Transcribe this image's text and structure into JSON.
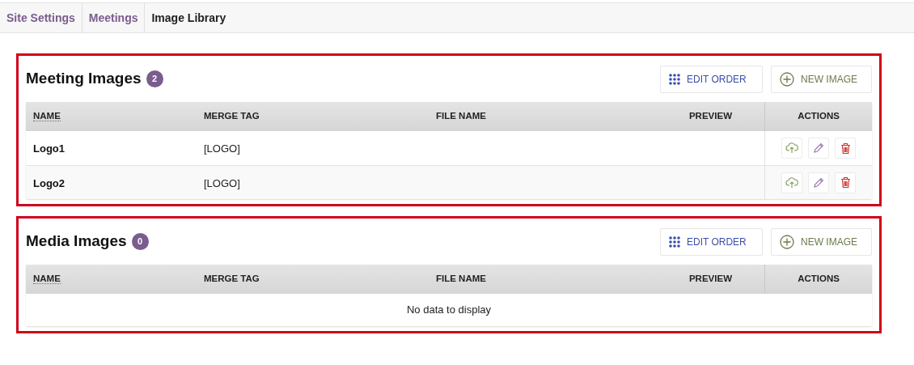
{
  "tabs": [
    {
      "label": "Site Settings",
      "selected": false
    },
    {
      "label": "Meetings",
      "selected": false
    },
    {
      "label": "Image Library",
      "selected": true
    }
  ],
  "sections": [
    {
      "title": "Meeting Images",
      "count": "2",
      "buttons": [
        {
          "kind": "edit-order",
          "label": "EDIT ORDER"
        },
        {
          "kind": "new",
          "label": "NEW IMAGE"
        }
      ],
      "columns": [
        "NAME",
        "MERGE TAG",
        "FILE NAME",
        "PREVIEW",
        "ACTIONS"
      ],
      "rows": [
        {
          "name": "Logo1",
          "merge_tag": "[LOGO]"
        },
        {
          "name": "Logo2",
          "merge_tag": "[LOGO]"
        }
      ]
    },
    {
      "title": "Media Images",
      "count": "0",
      "buttons": [
        {
          "kind": "edit-order",
          "label": "EDIT ORDER"
        },
        {
          "kind": "new",
          "label": "NEW IMAGE"
        }
      ],
      "columns": [
        "NAME",
        "MERGE TAG",
        "FILE NAME",
        "PREVIEW",
        "ACTIONS"
      ],
      "empty_text": "No data to display"
    }
  ]
}
